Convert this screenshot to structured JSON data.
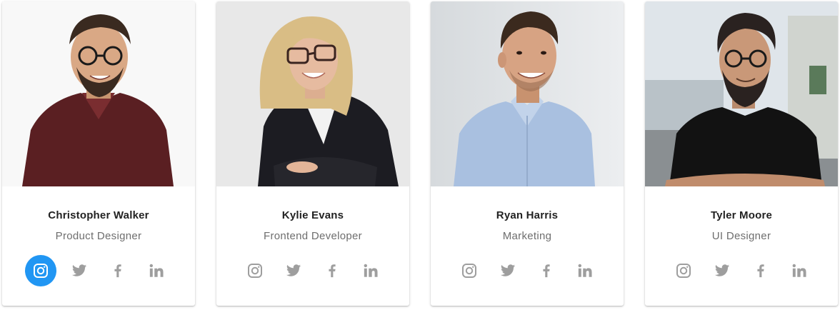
{
  "team": [
    {
      "name": "Christopher Walker",
      "role": "Product Designer",
      "active_social": "instagram",
      "background": "#f7f7f7",
      "shirt_color": "#5a1f22",
      "hair_color": "#3a2a20",
      "skin_color": "#d9a885"
    },
    {
      "name": "Kylie Evans",
      "role": "Frontend Developer",
      "active_social": "",
      "background": "#e9e9e9",
      "shirt_color": "#1c1c22",
      "hair_color": "#d9bd85",
      "skin_color": "#e6bba0"
    },
    {
      "name": "Ryan Harris",
      "role": "Marketing",
      "active_social": "",
      "background": "#dfe2e4",
      "shirt_color": "#a9c0e0",
      "hair_color": "#3b2a1e",
      "skin_color": "#d7a383"
    },
    {
      "name": "Tyler Moore",
      "role": "UI Designer",
      "active_social": "",
      "background": "#c9d2d8",
      "shirt_color": "#121212",
      "hair_color": "#2a2220",
      "skin_color": "#c99878"
    }
  ],
  "social_icons": [
    "instagram-icon",
    "twitter-icon",
    "facebook-icon",
    "linkedin-icon"
  ],
  "colors": {
    "accent": "#2196f3",
    "icon_gray": "#9e9e9e",
    "name_text": "#222222",
    "role_text": "#6e6e6e"
  }
}
